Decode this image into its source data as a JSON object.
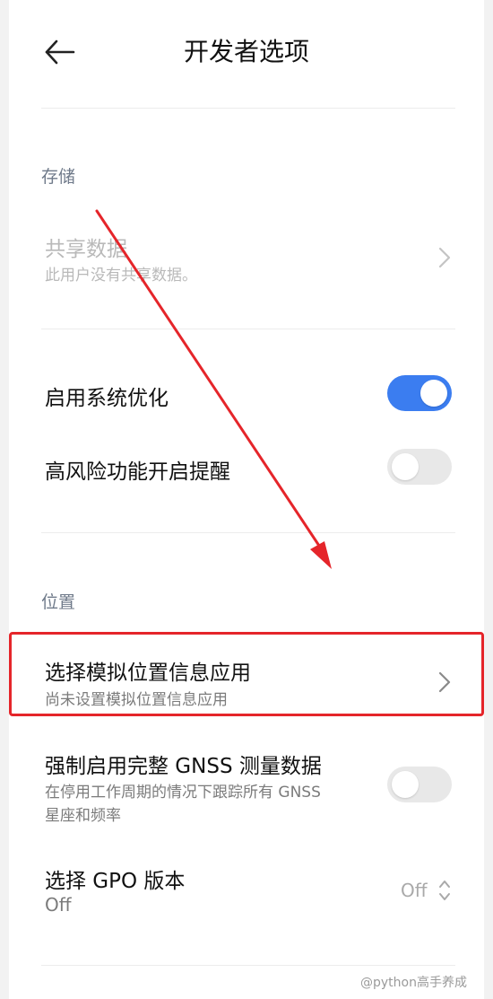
{
  "header": {
    "title": "开发者选项",
    "back_icon": "arrow-left-icon"
  },
  "storage": {
    "section_label": "存储",
    "shared_data": {
      "title": "共享数据",
      "subtitle": "此用户没有共享数据。",
      "enabled": false
    }
  },
  "optimization": {
    "system_opt": {
      "title": "启用系统优化",
      "toggle_on": true
    },
    "risk_alert": {
      "title": "高风险功能开启提醒",
      "toggle_on": false
    }
  },
  "location": {
    "section_label": "位置",
    "mock_app": {
      "title": "选择模拟位置信息应用",
      "subtitle": "尚未设置模拟位置信息应用"
    },
    "gnss": {
      "title": "强制启用完整 GNSS 测量数据",
      "subtitle_line1": "在停用工作周期的情况下跟踪所有 GNSS",
      "subtitle_line2": "星座和频率",
      "toggle_on": false
    },
    "gpo": {
      "title": "选择 GPO 版本",
      "subtitle": "Off",
      "value": "Off"
    }
  },
  "watermark": "@python高手养成",
  "colors": {
    "accent": "#3b7df0",
    "annotation": "#e5252a"
  }
}
